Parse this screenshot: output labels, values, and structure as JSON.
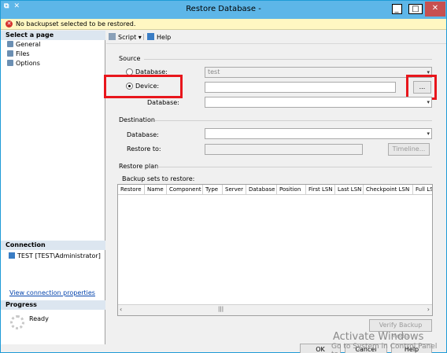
{
  "window": {
    "title": "Restore Database -",
    "controls": {
      "minimize": "_",
      "maximize": "□",
      "close": "✕"
    }
  },
  "message_bar": {
    "text": "No backupset selected to be restored."
  },
  "left_panel": {
    "select_page_heading": "Select a page",
    "pages": [
      {
        "label": "General"
      },
      {
        "label": "Files"
      },
      {
        "label": "Options"
      }
    ],
    "connection_heading": "Connection",
    "connection_text": "TEST [TEST\\Administrator]",
    "connection_link": "View connection properties",
    "progress_heading": "Progress",
    "progress_status": "Ready"
  },
  "toolbar": {
    "script_label": "Script",
    "help_label": "Help"
  },
  "source": {
    "heading": "Source",
    "database_radio": {
      "label": "Database:",
      "value": "test",
      "selected": false
    },
    "device_radio": {
      "label": "Device:",
      "value": "",
      "selected": true
    },
    "browse_button": "...",
    "device_database_label": "Database:",
    "device_database_value": ""
  },
  "destination": {
    "heading": "Destination",
    "database_label": "Database:",
    "database_value": "",
    "restore_to_label": "Restore to:",
    "restore_to_value": "",
    "timeline_button": "Timeline..."
  },
  "restore_plan": {
    "heading": "Restore plan",
    "backup_sets_label": "Backup sets to restore:",
    "columns": [
      "Restore",
      "Name",
      "Component",
      "Type",
      "Server",
      "Database",
      "Position",
      "First LSN",
      "Last LSN",
      "Checkpoint LSN",
      "Full LS"
    ],
    "rows": [],
    "verify_button": "Verify Backup Media"
  },
  "footer": {
    "ok_button": "OK",
    "cancel_button": "Cancel",
    "help_button": "Help"
  },
  "watermark": {
    "line1": "Activate Windows",
    "line2": "Go to System in Control Panel to"
  },
  "colors": {
    "titlebar": "#5db6e8",
    "close": "#c75050",
    "highlight": "#e8161c",
    "message_bar": "#fff7c2",
    "link": "#0645ad"
  }
}
